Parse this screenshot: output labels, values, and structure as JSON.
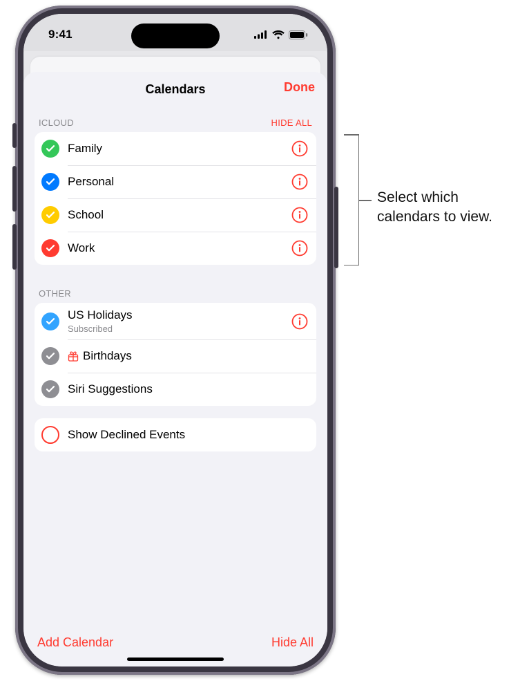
{
  "status": {
    "time": "9:41"
  },
  "sheet": {
    "title": "Calendars",
    "done": "Done"
  },
  "sections": {
    "icloud": {
      "label": "ICLOUD",
      "action": "HIDE ALL",
      "items": [
        {
          "name": "Family",
          "color": "#34c759",
          "checked": true,
          "has_info": true
        },
        {
          "name": "Personal",
          "color": "#007aff",
          "checked": true,
          "has_info": true
        },
        {
          "name": "School",
          "color": "#ffcc00",
          "checked": true,
          "has_info": true
        },
        {
          "name": "Work",
          "color": "#ff3b30",
          "checked": true,
          "has_info": true
        }
      ]
    },
    "other": {
      "label": "OTHER",
      "items": [
        {
          "name": "US Holidays",
          "sub": "Subscribed",
          "color": "#32a4ff",
          "checked": true,
          "has_info": true
        },
        {
          "name": "Birthdays",
          "icon": "gift",
          "color": "#8e8e93",
          "checked": true,
          "has_info": false
        },
        {
          "name": "Siri Suggestions",
          "color": "#8e8e93",
          "checked": true,
          "has_info": false
        }
      ]
    }
  },
  "options": {
    "show_declined": {
      "label": "Show Declined Events",
      "checked": false
    }
  },
  "footer": {
    "add": "Add Calendar",
    "hide_all": "Hide All"
  },
  "callout": {
    "text": "Select which calendars to view."
  },
  "colors": {
    "accent": "#ff3b30"
  }
}
